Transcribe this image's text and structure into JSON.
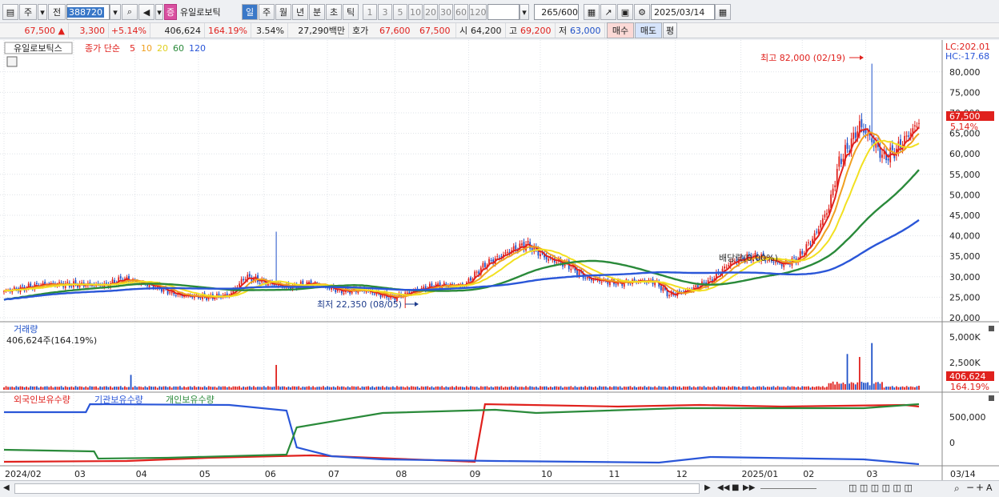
{
  "toolbar": {
    "market": "주",
    "prev": "전",
    "code": "388720",
    "type_badge": "증",
    "name": "유일로보틱",
    "periods": [
      "일",
      "주",
      "월",
      "년",
      "분",
      "초",
      "틱"
    ],
    "intervals": [
      "1",
      "3",
      "5",
      "10",
      "20",
      "30",
      "60",
      "120"
    ],
    "count": "265",
    "count_total": "/600",
    "date": "2025/03/14"
  },
  "quote": {
    "price": "67,500",
    "arrow": "▲",
    "change": "3,300",
    "pct": "+5.14%",
    "volume": "406,624",
    "vol_ratio": "164.19%",
    "turnover_rate": "3.54%",
    "amount": "27,290백만",
    "ask_label": "호가",
    "ask": "67,600",
    "bid": "67,500",
    "open_label": "시",
    "open": "64,200",
    "high_label": "고",
    "high": "69,200",
    "low_label": "저",
    "low": "63,000",
    "buy": "매수",
    "sell": "매도",
    "avg": "평"
  },
  "chart_data": {
    "type": "candlestick",
    "title": "유일로보틱스",
    "ma_label": "종가 단순",
    "ma_periods": [
      "5",
      "10",
      "20",
      "60",
      "120"
    ],
    "ma_colors": [
      "#e0211d",
      "#f0a020",
      "#f2e020",
      "#2a8a3a",
      "#2a56d8"
    ],
    "y_ticks": [
      "80,000",
      "75,000",
      "70,000",
      "65,000",
      "60,000",
      "55,000",
      "50,000",
      "45,000",
      "40,000",
      "35,000",
      "30,000",
      "25,000",
      "20,000"
    ],
    "ylim": [
      20000,
      82500
    ],
    "lc": "LC:202.01",
    "hc": "HC:-17.68",
    "last_price": "67,500",
    "last_pct": "5.14%",
    "high_note": "최고 82,000 (02/19)",
    "low_note": "최저 22,350 (08/05)",
    "div_note": "배당락(0.00%)",
    "months": [
      "2024/02",
      "03",
      "04",
      "05",
      "06",
      "07",
      "08",
      "09",
      "10",
      "11",
      "12",
      "2025/01",
      "02",
      "03",
      "03/14"
    ],
    "close_key": [
      [
        0,
        26500
      ],
      [
        20,
        28200
      ],
      [
        50,
        28000
      ],
      [
        58,
        29500
      ],
      [
        75,
        27500
      ],
      [
        85,
        25500
      ],
      [
        100,
        25000
      ],
      [
        110,
        25500
      ],
      [
        118,
        30000
      ],
      [
        128,
        28500
      ],
      [
        140,
        27500
      ],
      [
        150,
        28500
      ],
      [
        165,
        26500
      ],
      [
        175,
        26800
      ],
      [
        190,
        24800
      ],
      [
        200,
        26500
      ],
      [
        210,
        27800
      ],
      [
        225,
        28000
      ],
      [
        235,
        33000
      ],
      [
        248,
        36500
      ],
      [
        255,
        38000
      ],
      [
        265,
        34500
      ],
      [
        275,
        33000
      ],
      [
        285,
        29500
      ],
      [
        300,
        28500
      ],
      [
        310,
        29000
      ],
      [
        318,
        28800
      ],
      [
        325,
        25500
      ],
      [
        335,
        26800
      ],
      [
        345,
        29000
      ],
      [
        355,
        33500
      ],
      [
        365,
        35000
      ],
      [
        372,
        34500
      ],
      [
        380,
        33000
      ],
      [
        388,
        34500
      ],
      [
        396,
        40000
      ],
      [
        403,
        47000
      ],
      [
        408,
        58000
      ],
      [
        413,
        62000
      ],
      [
        418,
        67000
      ],
      [
        423,
        64000
      ],
      [
        430,
        59000
      ],
      [
        436,
        61000
      ],
      [
        444,
        66000
      ],
      [
        447,
        67500
      ]
    ],
    "volume": {
      "title": "거래량",
      "value_label": "406,624주(164.19%)",
      "y_ticks": [
        "5,000K",
        "2,500K"
      ],
      "last": "406,624",
      "last_pct": "164.19%"
    },
    "holdings": {
      "series": [
        "외국인보유수량",
        "기관보유수량",
        "개인보유수량"
      ],
      "colors": [
        "#e0211d",
        "#2a56d8",
        "#2a8a3a"
      ],
      "y_ticks": [
        "500,000",
        "0"
      ]
    }
  }
}
